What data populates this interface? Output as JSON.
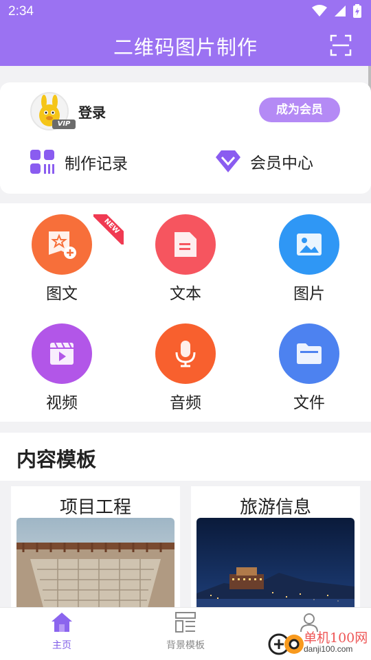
{
  "status": {
    "time": "2:34"
  },
  "appbar": {
    "title": "二维码图片制作",
    "scan_icon": "scan-icon"
  },
  "user": {
    "login_label": "登录",
    "vip_badge": "VIP",
    "member_button": "成为会员",
    "links": [
      {
        "label": "制作记录",
        "icon": "grid-record-icon"
      },
      {
        "label": "会员中心",
        "icon": "diamond-icon"
      }
    ]
  },
  "features": [
    {
      "label": "图文",
      "icon": "image-text-icon",
      "color": "#f76f3a"
    },
    {
      "label": "文本",
      "icon": "document-icon",
      "color": "#f6555f"
    },
    {
      "label": "图片",
      "icon": "picture-icon",
      "color": "#2f97f5"
    },
    {
      "label": "视频",
      "icon": "video-icon",
      "color": "#b256e8"
    },
    {
      "label": "音频",
      "icon": "microphone-icon",
      "color": "#f8602e"
    },
    {
      "label": "文件",
      "icon": "folder-icon",
      "color": "#4d82f0"
    }
  ],
  "new_ribbon": "NEW",
  "content_section": {
    "title": "内容模板"
  },
  "templates": [
    {
      "title": "项目工程"
    },
    {
      "title": "旅游信息"
    }
  ],
  "tabs": [
    {
      "label": "主页",
      "active": true
    },
    {
      "label": "背景模板",
      "active": false
    }
  ],
  "watermark": {
    "line1": "单机100网",
    "line2": "danji100.com"
  },
  "colors": {
    "primary": "#9b72f2",
    "member_button": "#b48af5",
    "tab_active": "#7f5ce8",
    "tab_inactive": "#888888"
  }
}
